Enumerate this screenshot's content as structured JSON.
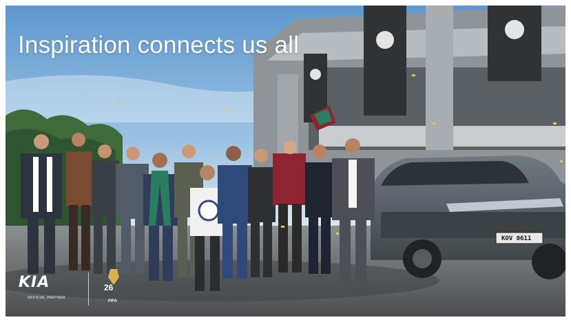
{
  "headline": "Inspiration connects us all",
  "brand": {
    "logo_text": "KIA",
    "partner_caption": "OFFICIAL PARTNER"
  },
  "event_badge": {
    "caption": "FIFA"
  },
  "vehicle": {
    "plate": "KOV 0611"
  },
  "icons": [
    "kia-logo",
    "trophy-badge-icon"
  ],
  "colors": {
    "sky": "#6fa6d6",
    "stadium": "#8f9498",
    "car_body": "#5c676c",
    "scarf_red": "#8e2430",
    "scarf_green": "#2a7d5e",
    "headline": "#ffffff"
  }
}
